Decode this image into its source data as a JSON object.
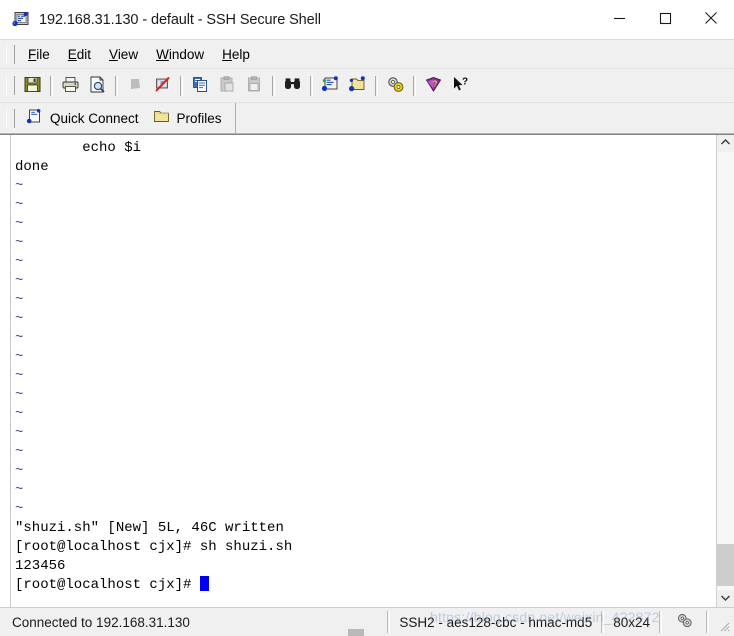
{
  "window": {
    "title": "192.168.31.130 - default - SSH Secure Shell",
    "app_icon": "ssh-terminal-icon",
    "controls": {
      "minimize": "minimize-icon",
      "maximize": "maximize-icon",
      "close": "close-icon"
    }
  },
  "menubar": {
    "items": [
      {
        "label": "File",
        "mnemonic": "F"
      },
      {
        "label": "Edit",
        "mnemonic": "E"
      },
      {
        "label": "View",
        "mnemonic": "V"
      },
      {
        "label": "Window",
        "mnemonic": "W"
      },
      {
        "label": "Help",
        "mnemonic": "H"
      }
    ]
  },
  "toolbar": {
    "buttons": [
      {
        "name": "save-icon",
        "title": "Save",
        "enabled": true
      },
      {
        "name": "print-icon",
        "title": "Print",
        "enabled": true
      },
      {
        "name": "print-preview-icon",
        "title": "Print Preview",
        "enabled": true
      },
      {
        "name": "connect-icon",
        "title": "Connect",
        "enabled": false
      },
      {
        "name": "disconnect-icon",
        "title": "Disconnect",
        "enabled": true
      },
      {
        "name": "copy-icon",
        "title": "Copy",
        "enabled": true
      },
      {
        "name": "paste-icon",
        "title": "Paste",
        "enabled": false
      },
      {
        "name": "paste-clipboard-icon",
        "title": "Paste",
        "enabled": false
      },
      {
        "name": "find-icon",
        "title": "Find",
        "enabled": true
      },
      {
        "name": "new-terminal-icon",
        "title": "New Terminal",
        "enabled": true
      },
      {
        "name": "new-file-transfer-icon",
        "title": "New File Transfer",
        "enabled": true
      },
      {
        "name": "settings-icon",
        "title": "Settings",
        "enabled": true
      },
      {
        "name": "help-book-icon",
        "title": "Help",
        "enabled": true
      },
      {
        "name": "context-help-icon",
        "title": "Context Help",
        "enabled": true
      }
    ]
  },
  "quickbar": {
    "quick_connect": "Quick Connect",
    "profiles": "Profiles"
  },
  "terminal": {
    "lines": [
      "        echo $i",
      "done",
      "~",
      "~",
      "~",
      "~",
      "~",
      "~",
      "~",
      "~",
      "~",
      "~",
      "~",
      "~",
      "~",
      "~",
      "~",
      "~",
      "~",
      "~",
      "\"shuzi.sh\" [New] 5L, 46C written",
      "[root@localhost cjx]# sh shuzi.sh",
      "123456",
      "[root@localhost cjx]# "
    ],
    "cursor_line_index": 23,
    "cursor_color": "#0000ee",
    "tilde_color": "#4a4a8a",
    "background": "#ffffff",
    "foreground": "#000000"
  },
  "scrollbar": {
    "up_arrow": "chevron-up-icon",
    "down_arrow": "chevron-down-icon"
  },
  "statusbar": {
    "connection": "Connected to 192.168.31.130",
    "cipher": "SSH2 - aes128-cbc - hmac-md5",
    "size": "80x24",
    "icon": "settings-gear-icon"
  },
  "watermark": {
    "text": "https://blog.csdn.net/weixin_4?2872"
  }
}
